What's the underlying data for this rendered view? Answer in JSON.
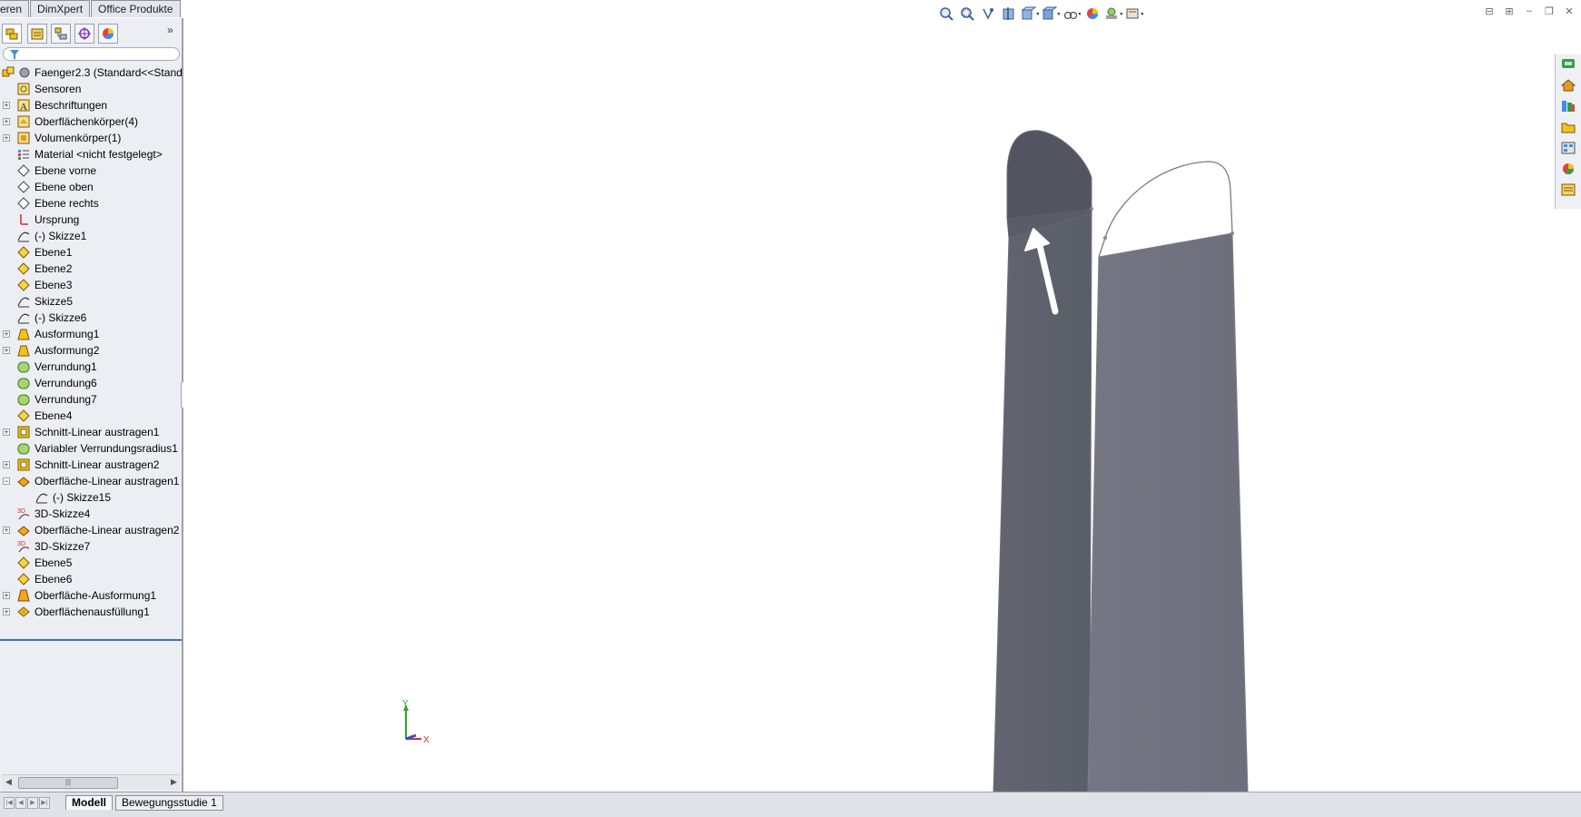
{
  "command_tabs": [
    "eren",
    "DimXpert",
    "Office Produkte"
  ],
  "feature_tree": {
    "root": "Faenger2.3  (Standard<<Standa",
    "items": [
      {
        "label": "Sensoren",
        "icon": "sensor-icon",
        "expand": false,
        "indent": 0
      },
      {
        "label": "Beschriftungen",
        "icon": "annotation-icon",
        "expand": true,
        "indent": 0
      },
      {
        "label": "Oberflächenkörper(4)",
        "icon": "surface-bodies-icon",
        "expand": true,
        "indent": 0
      },
      {
        "label": "Volumenkörper(1)",
        "icon": "solid-bodies-icon",
        "expand": true,
        "indent": 0
      },
      {
        "label": "Material <nicht festgelegt>",
        "icon": "material-icon",
        "expand": false,
        "indent": 0
      },
      {
        "label": "Ebene vorne",
        "icon": "plane-icon",
        "expand": false,
        "indent": 0
      },
      {
        "label": "Ebene oben",
        "icon": "plane-icon",
        "expand": false,
        "indent": 0
      },
      {
        "label": "Ebene rechts",
        "icon": "plane-icon",
        "expand": false,
        "indent": 0
      },
      {
        "label": "Ursprung",
        "icon": "origin-icon",
        "expand": false,
        "indent": 0
      },
      {
        "label": "(-) Skizze1",
        "icon": "sketch-icon",
        "expand": false,
        "indent": 0
      },
      {
        "label": "Ebene1",
        "icon": "ref-plane-icon",
        "expand": false,
        "indent": 0
      },
      {
        "label": "Ebene2",
        "icon": "ref-plane-icon",
        "expand": false,
        "indent": 0
      },
      {
        "label": "Ebene3",
        "icon": "ref-plane-icon",
        "expand": false,
        "indent": 0
      },
      {
        "label": "Skizze5",
        "icon": "sketch-icon",
        "expand": false,
        "indent": 0
      },
      {
        "label": "(-) Skizze6",
        "icon": "sketch-icon",
        "expand": false,
        "indent": 0
      },
      {
        "label": "Ausformung1",
        "icon": "loft-icon",
        "expand": true,
        "indent": 0
      },
      {
        "label": "Ausformung2",
        "icon": "loft-icon",
        "expand": true,
        "indent": 0
      },
      {
        "label": "Verrundung1",
        "icon": "fillet-icon",
        "expand": false,
        "indent": 0
      },
      {
        "label": "Verrundung6",
        "icon": "fillet-icon",
        "expand": false,
        "indent": 0
      },
      {
        "label": "Verrundung7",
        "icon": "fillet-icon",
        "expand": false,
        "indent": 0
      },
      {
        "label": "Ebene4",
        "icon": "ref-plane-icon",
        "expand": false,
        "indent": 0
      },
      {
        "label": "Schnitt-Linear austragen1",
        "icon": "cut-extrude-icon",
        "expand": true,
        "indent": 0
      },
      {
        "label": "Variabler Verrundungsradius1",
        "icon": "fillet-icon",
        "expand": false,
        "indent": 0
      },
      {
        "label": "Schnitt-Linear austragen2",
        "icon": "cut-extrude-icon",
        "expand": true,
        "indent": 0
      },
      {
        "label": "Oberfläche-Linear austragen1",
        "icon": "surface-extrude-icon",
        "expand": true,
        "expanded": true,
        "indent": 0
      },
      {
        "label": "(-) Skizze15",
        "icon": "sketch-icon",
        "expand": false,
        "indent": 1
      },
      {
        "label": "3D-Skizze4",
        "icon": "3d-sketch-icon",
        "expand": false,
        "indent": 0
      },
      {
        "label": "Oberfläche-Linear austragen2",
        "icon": "surface-extrude-icon",
        "expand": true,
        "indent": 0
      },
      {
        "label": "3D-Skizze7",
        "icon": "3d-sketch-icon",
        "expand": false,
        "indent": 0
      },
      {
        "label": "Ebene5",
        "icon": "ref-plane-icon",
        "expand": false,
        "indent": 0
      },
      {
        "label": "Ebene6",
        "icon": "ref-plane-icon",
        "expand": false,
        "indent": 0
      },
      {
        "label": "Oberfläche-Ausformung1",
        "icon": "surface-loft-icon",
        "expand": true,
        "indent": 0
      },
      {
        "label": "Oberflächenausfüllung1",
        "icon": "surface-fill-icon",
        "expand": true,
        "indent": 0
      }
    ]
  },
  "bottom_tabs": [
    "Modell",
    "Bewegungsstudie 1"
  ],
  "triad": {
    "y": "Y",
    "x": "X"
  },
  "colors": {
    "surface_dark": "#5d616c",
    "surface_light": "#727581",
    "edge": "#777b85",
    "arrow": "#ffffff",
    "accent": "#3b6fc1"
  }
}
